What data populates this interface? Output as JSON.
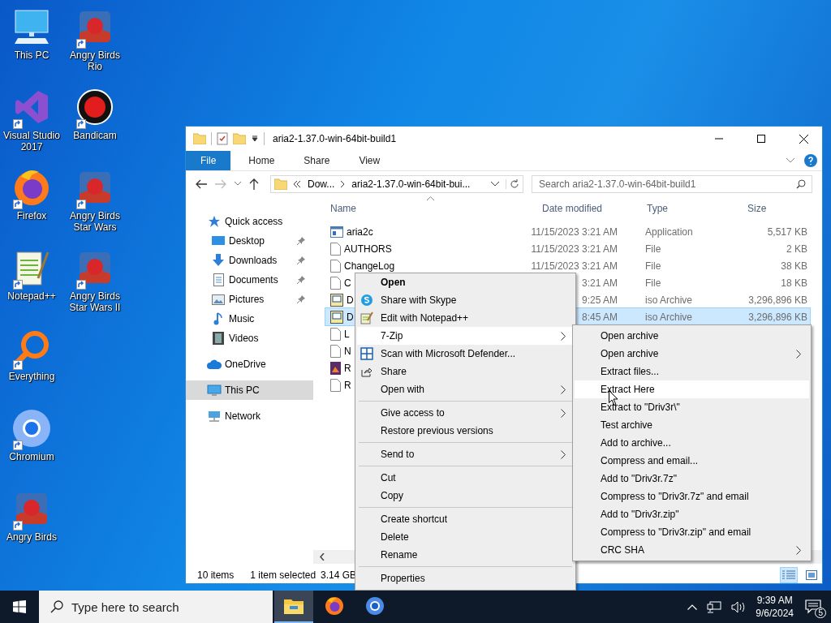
{
  "desktop": {
    "icons": [
      {
        "label": "This PC",
        "kind": "pc",
        "shortcut": false
      },
      {
        "label": "Visual Studio 2017",
        "kind": "vs",
        "shortcut": true
      },
      {
        "label": "Firefox",
        "kind": "fox",
        "shortcut": true
      },
      {
        "label": "Notepad++",
        "kind": "notepad",
        "shortcut": true
      },
      {
        "label": "Everything",
        "kind": "ring",
        "shortcut": true
      },
      {
        "label": "Chromium",
        "kind": "chromium",
        "shortcut": true
      },
      {
        "label": "Angry Birds",
        "kind": "game",
        "shortcut": true
      },
      {
        "label": "Angry Birds Rio",
        "kind": "game",
        "shortcut": true
      },
      {
        "label": "Bandicam",
        "kind": "record",
        "shortcut": true
      },
      {
        "label": "Angry Birds Star Wars",
        "kind": "game",
        "shortcut": true
      },
      {
        "label": "Angry Birds Star Wars II",
        "kind": "game",
        "shortcut": true
      }
    ]
  },
  "window": {
    "title": "aria2-1.37.0-win-64bit-build1",
    "ribbon_tabs": [
      {
        "label": "File",
        "selected": true
      },
      {
        "label": "Home",
        "selected": false
      },
      {
        "label": "Share",
        "selected": false
      },
      {
        "label": "View",
        "selected": false
      }
    ],
    "address": {
      "segments": [
        "Dow...",
        "aria2-1.37.0-win-64bit-bui..."
      ]
    },
    "search": {
      "placeholder": "Search aria2-1.37.0-win-64bit-build1"
    },
    "sidebar": {
      "items": [
        {
          "label": "Quick access",
          "kind": "star",
          "pinned": false,
          "selected": false,
          "children": [
            {
              "label": "Desktop",
              "kind": "desktop",
              "pinned": true,
              "selected": false
            },
            {
              "label": "Downloads",
              "kind": "download",
              "pinned": true,
              "selected": false
            },
            {
              "label": "Documents",
              "kind": "document",
              "pinned": true,
              "selected": false
            },
            {
              "label": "Pictures",
              "kind": "picture",
              "pinned": true,
              "selected": false
            },
            {
              "label": "Music",
              "kind": "music",
              "pinned": false,
              "selected": false
            },
            {
              "label": "Videos",
              "kind": "video",
              "pinned": false,
              "selected": false
            }
          ]
        },
        {
          "label": "OneDrive",
          "kind": "cloud",
          "pinned": false,
          "selected": false
        },
        {
          "label": "This PC",
          "kind": "pc",
          "pinned": false,
          "selected": true
        },
        {
          "label": "Network",
          "kind": "network",
          "pinned": false,
          "selected": false
        }
      ]
    },
    "table": {
      "columns": [
        "Name",
        "Date modified",
        "Type",
        "Size"
      ],
      "rows": [
        {
          "kind": "app",
          "name": "aria2c",
          "date": "11/15/2023 3:21 AM",
          "type": "Application",
          "size": "5,517 KB",
          "selected": false
        },
        {
          "kind": "file",
          "name": "AUTHORS",
          "date": "11/15/2023 3:21 AM",
          "type": "File",
          "size": "2 KB",
          "selected": false
        },
        {
          "kind": "file",
          "name": "ChangeLog",
          "date": "11/15/2023 3:21 AM",
          "type": "File",
          "size": "38 KB",
          "selected": false
        },
        {
          "kind": "file",
          "name": "C",
          "date": "3:21 AM",
          "type": "File",
          "size": "18 KB",
          "selected": false
        },
        {
          "kind": "iso",
          "name": "D",
          "date": "9:25 AM",
          "type": "iso Archive",
          "size": "3,296,896 KB",
          "selected": false
        },
        {
          "kind": "iso",
          "name": "D",
          "date": "8:45 AM",
          "type": "iso Archive",
          "size": "3,296,896 KB",
          "selected": true
        },
        {
          "kind": "file",
          "name": "L",
          "selected": false
        },
        {
          "kind": "file",
          "name": "N",
          "selected": false
        },
        {
          "kind": "image",
          "name": "R",
          "selected": false
        },
        {
          "kind": "file",
          "name": "R",
          "selected": false
        }
      ]
    },
    "status_bar": {
      "item_count": "10 items",
      "selection": "1 item selected",
      "selection_size": "3.14 GB",
      "views": [
        {
          "kind": "details",
          "selected": true
        },
        {
          "kind": "tiles",
          "selected": false
        }
      ]
    }
  },
  "context_menu": {
    "items": [
      {
        "kind": "plain",
        "label": "Open",
        "default": true,
        "submenu": false,
        "selected": false
      },
      {
        "kind": "chat",
        "label": "Share with Skype",
        "default": false,
        "submenu": false,
        "selected": false
      },
      {
        "kind": "notepad",
        "label": "Edit with Notepad++",
        "default": false,
        "submenu": false,
        "selected": false
      },
      {
        "kind": "plain",
        "label": "7-Zip",
        "default": false,
        "submenu": true,
        "selected": true
      },
      {
        "kind": "shield",
        "label": "Scan with Microsoft Defender...",
        "default": false,
        "submenu": false,
        "selected": false
      },
      {
        "kind": "share",
        "label": "Share",
        "default": false,
        "submenu": false,
        "selected": false
      },
      {
        "kind": "plain",
        "label": "Open with",
        "default": false,
        "submenu": true,
        "selected": false
      },
      {
        "kind": "separator"
      },
      {
        "kind": "plain",
        "label": "Give access to",
        "default": false,
        "submenu": true,
        "selected": false
      },
      {
        "kind": "plain",
        "label": "Restore previous versions",
        "default": false,
        "submenu": false,
        "selected": false
      },
      {
        "kind": "separator"
      },
      {
        "kind": "plain",
        "label": "Send to",
        "default": false,
        "submenu": true,
        "selected": false
      },
      {
        "kind": "separator"
      },
      {
        "kind": "plain",
        "label": "Cut",
        "default": false,
        "submenu": false,
        "selected": false
      },
      {
        "kind": "plain",
        "label": "Copy",
        "default": false,
        "submenu": false,
        "selected": false
      },
      {
        "kind": "separator"
      },
      {
        "kind": "plain",
        "label": "Create shortcut",
        "default": false,
        "submenu": false,
        "selected": false
      },
      {
        "kind": "plain",
        "label": "Delete",
        "default": false,
        "submenu": false,
        "selected": false
      },
      {
        "kind": "plain",
        "label": "Rename",
        "default": false,
        "submenu": false,
        "selected": false
      },
      {
        "kind": "separator"
      },
      {
        "kind": "plain",
        "label": "Properties",
        "default": false,
        "submenu": false,
        "selected": false
      }
    ]
  },
  "submenu": {
    "items": [
      {
        "label": "Open archive",
        "submenu": false,
        "selected": false
      },
      {
        "label": "Open archive",
        "submenu": true,
        "selected": false
      },
      {
        "label": "Extract files...",
        "submenu": false,
        "selected": false
      },
      {
        "label": "Extract Here",
        "submenu": false,
        "selected": true
      },
      {
        "label": "Extract to \"Driv3r\\\"",
        "submenu": false,
        "selected": false
      },
      {
        "label": "Test archive",
        "submenu": false,
        "selected": false
      },
      {
        "label": "Add to archive...",
        "submenu": false,
        "selected": false
      },
      {
        "label": "Compress and email...",
        "submenu": false,
        "selected": false
      },
      {
        "label": "Add to \"Driv3r.7z\"",
        "submenu": false,
        "selected": false
      },
      {
        "label": "Compress to \"Driv3r.7z\" and email",
        "submenu": false,
        "selected": false
      },
      {
        "label": "Add to \"Driv3r.zip\"",
        "submenu": false,
        "selected": false
      },
      {
        "label": "Compress to \"Driv3r.zip\" and email",
        "submenu": false,
        "selected": false
      },
      {
        "label": "CRC SHA",
        "submenu": true,
        "selected": false
      }
    ]
  },
  "taskbar": {
    "search": {
      "placeholder": "Type here to search"
    },
    "apps": [
      {
        "kind": "explorer",
        "selected": true
      },
      {
        "kind": "firefox",
        "selected": false
      },
      {
        "kind": "chromium",
        "selected": false
      }
    ],
    "time": "9:39 AM",
    "date": "9/6/2024",
    "notifications": "5"
  }
}
